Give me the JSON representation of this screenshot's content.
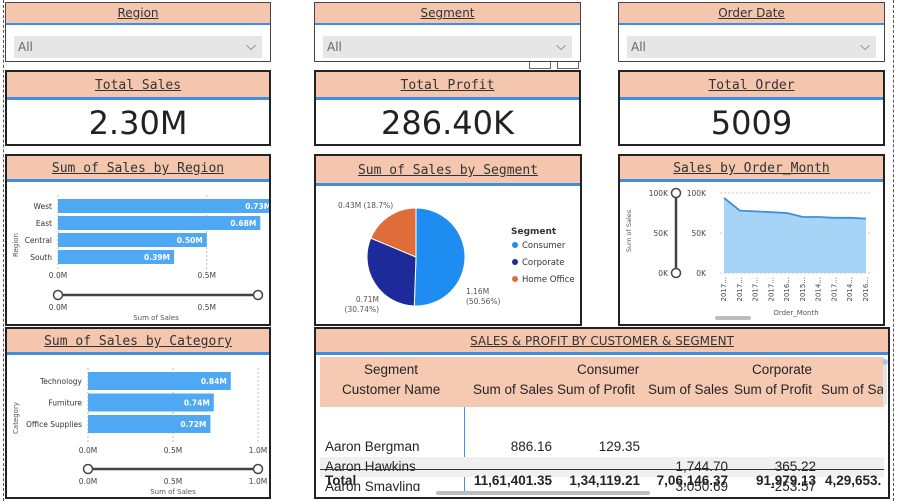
{
  "slicers": [
    {
      "label": "Region",
      "value": "All"
    },
    {
      "label": "Segment",
      "value": "All"
    },
    {
      "label": "Order Date",
      "value": "All"
    }
  ],
  "kpis": [
    {
      "label": "Total Sales",
      "value": "2.30M"
    },
    {
      "label": "Total Profit",
      "value": "286.40K"
    },
    {
      "label": "Total Order",
      "value": "5009"
    }
  ],
  "colors": {
    "header_fill": "#f4c6ae",
    "accent_blue": "#3f8ee0",
    "bar": "#4fa8f4",
    "consumer": "#1e8cf0",
    "corporate": "#1d2a99",
    "home_office": "#e06c3a"
  },
  "region_chart": {
    "title": "Sum of Sales by Region",
    "ylabel": "Region",
    "xlabel": "Sum of Sales",
    "chart_data": {
      "type": "bar",
      "categories": [
        "West",
        "East",
        "Central",
        "South"
      ],
      "values": [
        0.73,
        0.68,
        0.5,
        0.39
      ],
      "data_labels": [
        "0.73M",
        "0.68M",
        "0.50M",
        "0.39M"
      ],
      "x_ticks": [
        "0.0M",
        "0.5M"
      ],
      "xlim": [
        0,
        0.8
      ],
      "slider_labels": [
        "0.0M",
        "0.5M"
      ]
    }
  },
  "category_chart": {
    "title": "Sum of Sales by Category",
    "ylabel": "Category",
    "xlabel": "Sum of Sales",
    "chart_data": {
      "type": "bar",
      "categories": [
        "Technology",
        "Furniture",
        "Office Supplies"
      ],
      "values": [
        0.84,
        0.74,
        0.72
      ],
      "data_labels": [
        "0.84M",
        "0.74M",
        "0.72M"
      ],
      "x_ticks": [
        "0.0M",
        "0.5M",
        "1.0M"
      ],
      "xlim": [
        0,
        1.0
      ],
      "slider_labels": [
        "0.0M",
        "0.5M",
        "1.0M"
      ]
    }
  },
  "segment_chart": {
    "title": "Sum of Sales by Segment",
    "legend_title": "Segment",
    "chart_data": {
      "type": "pie",
      "categories": [
        "Consumer",
        "Corporate",
        "Home Office"
      ],
      "values": [
        50.56,
        30.74,
        18.7
      ],
      "value_labels": [
        "1.16M",
        "0.71M",
        "0.43M (18.7%)"
      ],
      "pct_labels": [
        "(50.56%)",
        "(30.74%)",
        ""
      ]
    }
  },
  "month_chart": {
    "title": "Sales by Order_Month",
    "ylabel": "Sum of Sales",
    "xlabel": "Order_Month",
    "chart_data": {
      "type": "area",
      "x": [
        "2017...",
        "2017...",
        "2017...",
        "2017...",
        "2016...",
        "2015...",
        "2014...",
        "2017...",
        "2014...",
        "2016..."
      ],
      "values": [
        94,
        78,
        77,
        76,
        75,
        70,
        70,
        69,
        69,
        68
      ],
      "y_ticks": [
        "0K",
        "50K",
        "100K"
      ],
      "ylim": [
        0,
        100
      ],
      "slider_labels": [
        "100K",
        "50K",
        "0K"
      ]
    }
  },
  "matrix": {
    "title": "SALES & PROFIT BY CUSTOMER & SEGMENT",
    "row_header_segment": "Segment",
    "row_header_customer": "Customer Name",
    "groups": [
      "Consumer",
      "Corporate"
    ],
    "measure_headers": [
      "Sum of Sales",
      "Sum of Profit",
      "Sum of Sales",
      "Sum of Profit",
      "Sum of Sa"
    ],
    "rows": [
      {
        "name": "Aaron Bergman",
        "cells": [
          "886.16",
          "129.35",
          "",
          "",
          ""
        ]
      },
      {
        "name": "Aaron Hawkins",
        "cells": [
          "",
          "",
          "1,744.70",
          "365.22",
          ""
        ]
      },
      {
        "name": "Aaron Smayling",
        "cells": [
          "",
          "",
          "3,050.69",
          "-253.57",
          ""
        ]
      }
    ],
    "total": {
      "name": "Total",
      "cells": [
        "11,61,401.35",
        "1,34,119.21",
        "7,06,146.37",
        "91,979.13",
        "4,29,653."
      ]
    }
  }
}
